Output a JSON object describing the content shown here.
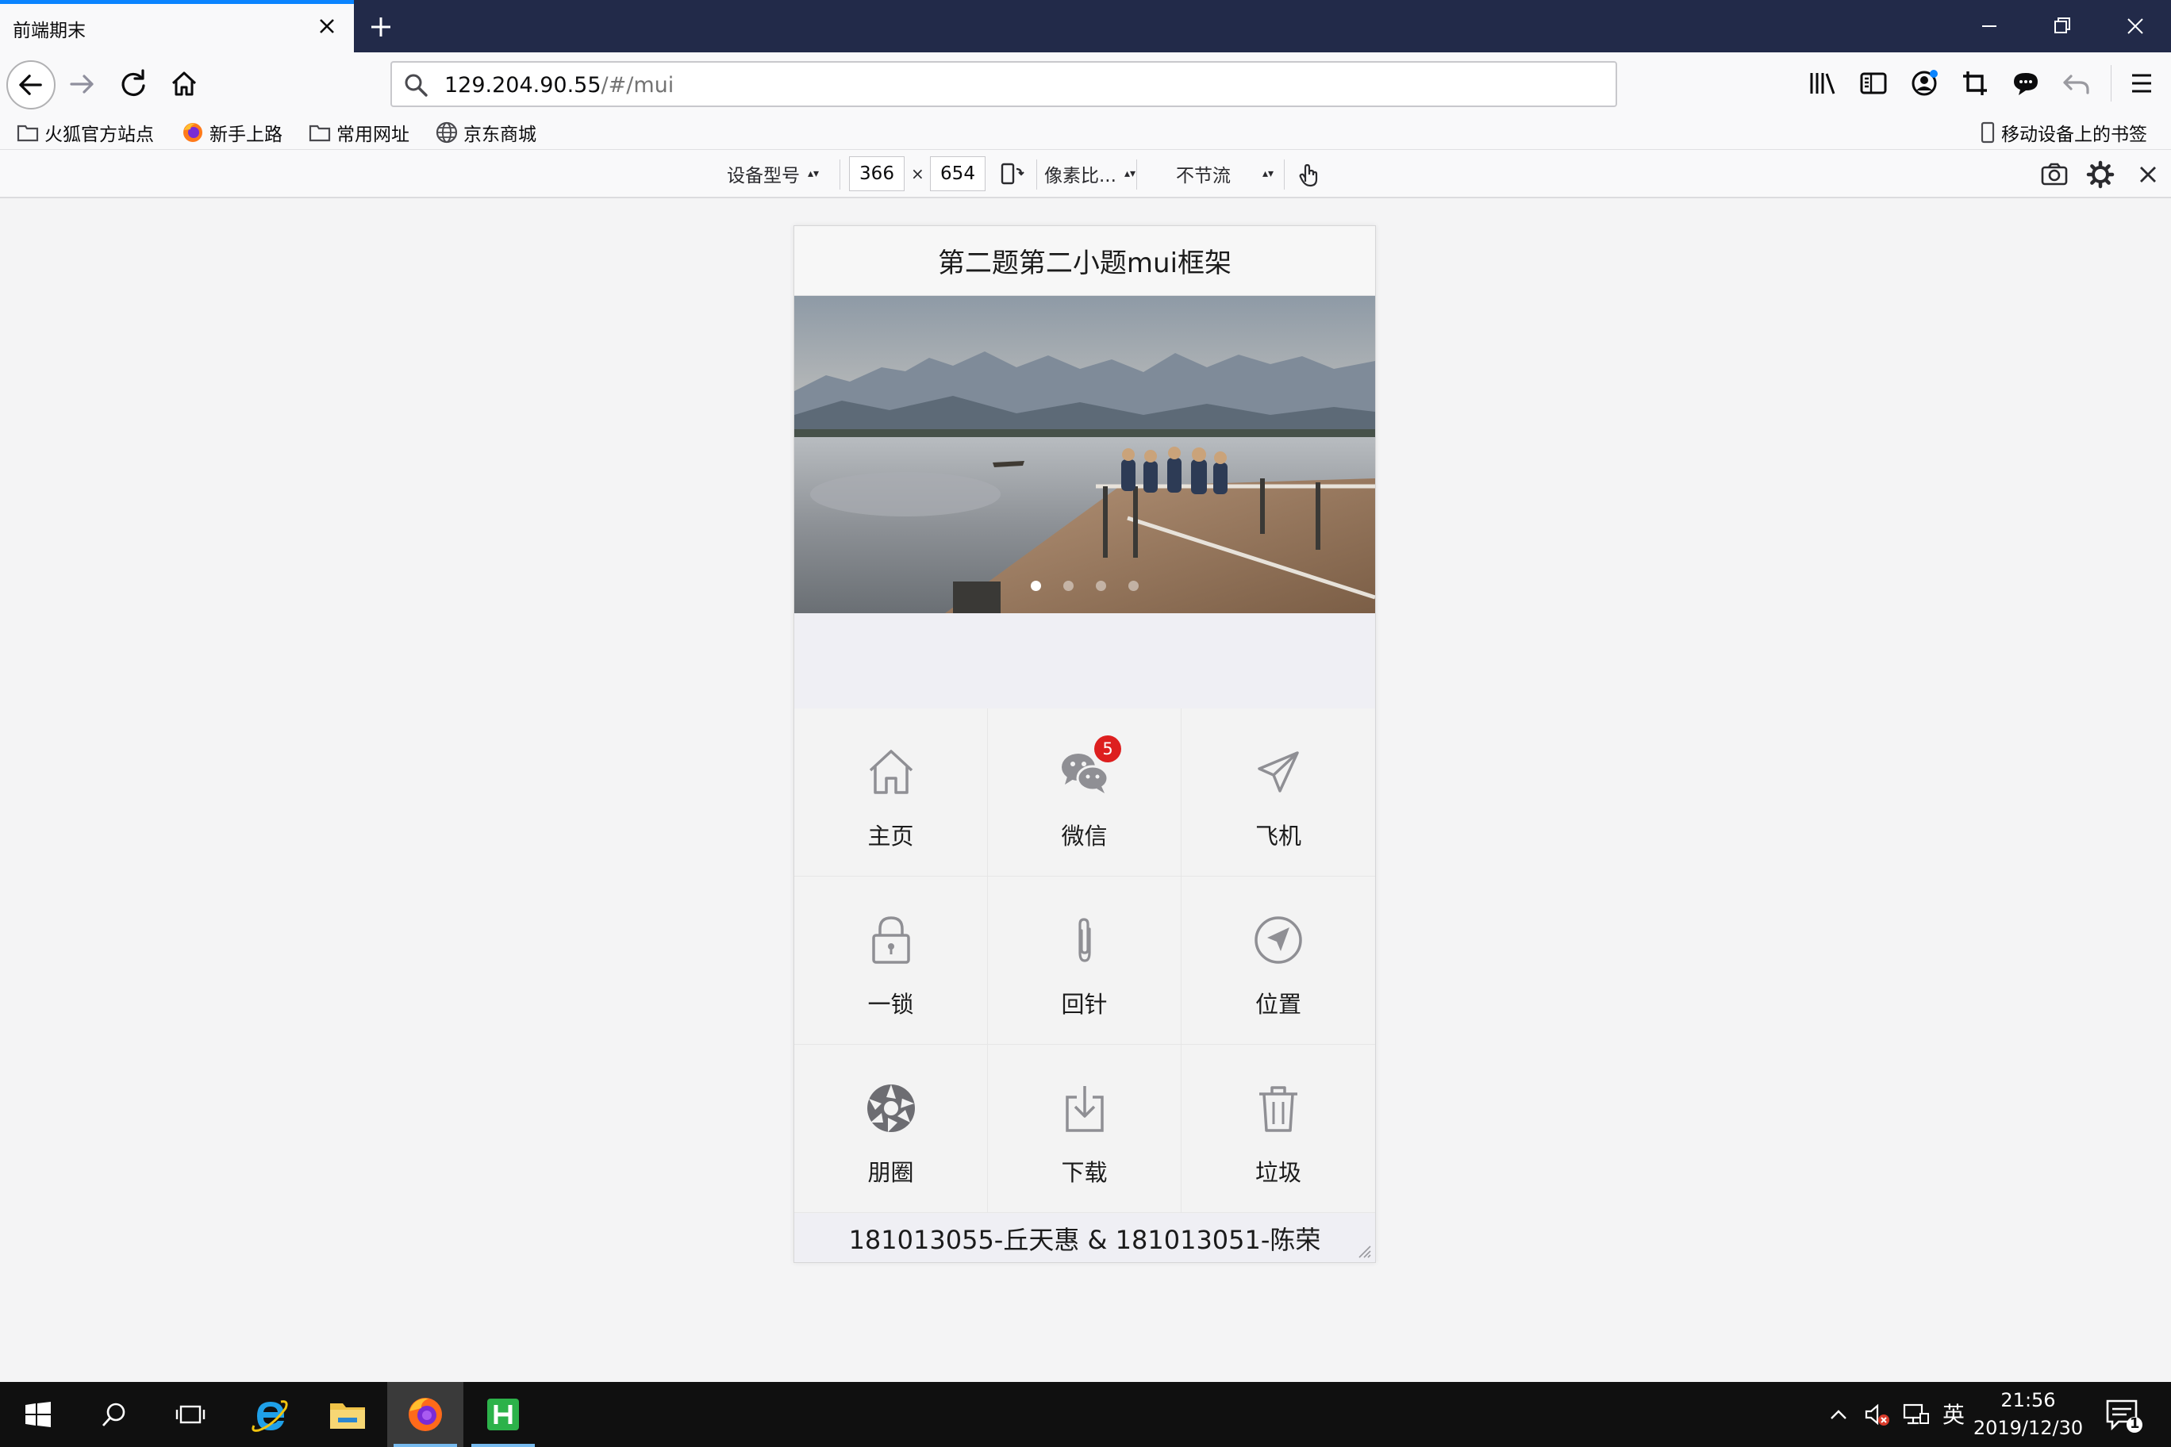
{
  "browser": {
    "tab_title": "前端期末",
    "url_host": "129.204.90.55",
    "url_path": "/#/mui",
    "bookmarks": [
      {
        "label": "火狐官方站点",
        "icon": "folder-icon"
      },
      {
        "label": "新手上路",
        "icon": "firefox-icon"
      },
      {
        "label": "常用网址",
        "icon": "folder-icon"
      },
      {
        "label": "京东商城",
        "icon": "globe-icon"
      }
    ],
    "mobile_bookmarks": "移动设备上的书签"
  },
  "rdm": {
    "device_label": "设备型号",
    "width": "366",
    "times": "×",
    "height": "654",
    "dpr_label": "像素比...",
    "throttle_label": "不节流"
  },
  "mobile": {
    "header_title": "第二题第二小题mui框架",
    "slider_dots": 4,
    "active_dot": 0,
    "grid": [
      {
        "label": "主页",
        "icon": "home-icon"
      },
      {
        "label": "微信",
        "icon": "wechat-icon",
        "badge": "5"
      },
      {
        "label": "飞机",
        "icon": "paper-plane-icon"
      },
      {
        "label": "一锁",
        "icon": "lock-icon"
      },
      {
        "label": "回针",
        "icon": "paperclip-icon"
      },
      {
        "label": "位置",
        "icon": "location-icon"
      },
      {
        "label": "朋圈",
        "icon": "camera-aperture-icon"
      },
      {
        "label": "下载",
        "icon": "download-icon"
      },
      {
        "label": "垃圾",
        "icon": "trash-icon"
      }
    ],
    "footer_text": "181013055-丘天惠 & 181013051-陈荣"
  },
  "taskbar": {
    "ime": "英",
    "time": "21:56",
    "date": "2019/12/30",
    "notification_count": "1"
  },
  "colors": {
    "titlebar": "#222a49",
    "tab_accent": "#0a84ff",
    "badge": "#dd1f1f",
    "taskbar": "#101010"
  }
}
